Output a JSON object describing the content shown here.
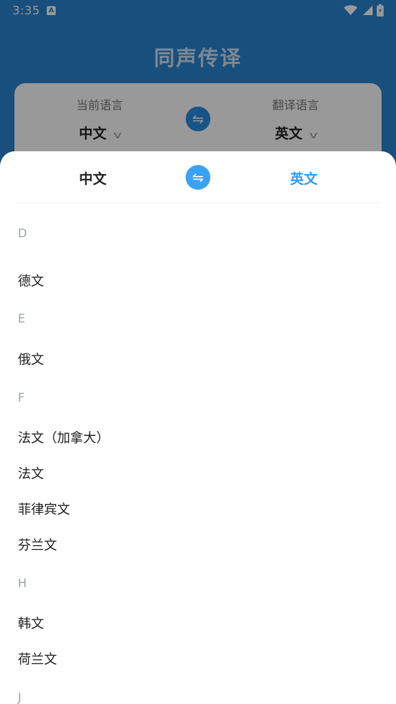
{
  "status_bar": {
    "time": "3:35",
    "notification_icon": "a-icon",
    "icons": [
      "wifi-icon",
      "signal-icon",
      "battery-icon"
    ]
  },
  "app": {
    "title": "同声传译",
    "current_label": "当前语言",
    "current_value": "中文",
    "target_label": "翻译语言",
    "target_value": "英文",
    "swap_icon": "swap-icon"
  },
  "sheet": {
    "source": "中文",
    "target": "英文",
    "swap_icon": "swap-icon",
    "accent_color": "#2f9bf0",
    "groups": [
      {
        "letter": "D",
        "items": [
          "德文"
        ]
      },
      {
        "letter": "E",
        "items": [
          "俄文"
        ]
      },
      {
        "letter": "F",
        "items": [
          "法文（加拿大）",
          "法文",
          "菲律宾文",
          "芬兰文"
        ]
      },
      {
        "letter": "H",
        "items": [
          "韩文",
          "荷兰文"
        ]
      },
      {
        "letter": "J",
        "items": []
      }
    ]
  }
}
